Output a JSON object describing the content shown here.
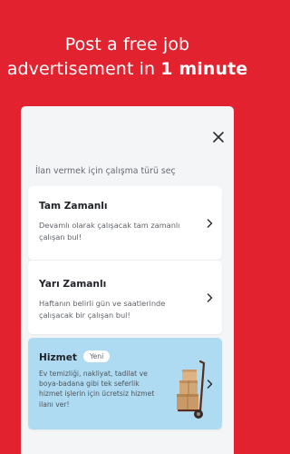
{
  "headline": {
    "line1": "Post a free job",
    "line2_pre": "advertisement in ",
    "line2_bold": "1 minute"
  },
  "sheet": {
    "prompt": "İlan vermek için çalışma türü seç",
    "options": [
      {
        "title": "Tam Zamanlı",
        "description": "Devamlı olarak çalışacak tam zamanlı çalışan bul!"
      },
      {
        "title": "Yarı Zamanlı",
        "description": "Haftanın belirli gün ve saatlerinde çalışacak bir çalışan bul!"
      },
      {
        "title": "Hizmet",
        "badge": "Yeni",
        "description": "Ev temizliği, nakliyat, tadilat ve boya-badana gibi tek seferlik hizmet işlerin için ücretsiz hizmet ilanı ver!"
      }
    ]
  },
  "colors": {
    "brand_red": "#E3222F",
    "service_card_bg": "#AFDBF2",
    "sheet_bg": "#F4F5F7"
  },
  "icons": {
    "close": "close-icon",
    "chevron": "chevron-right-icon",
    "illustration": "hand-truck-boxes-illustration"
  }
}
